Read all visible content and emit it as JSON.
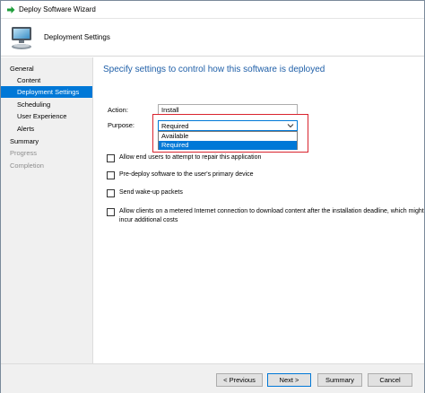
{
  "window": {
    "title": "Deploy Software Wizard",
    "accent_color": "#0078d7"
  },
  "header": {
    "page_name": "Deployment Settings"
  },
  "sidebar": {
    "items": [
      {
        "label": "General",
        "state": "normal"
      },
      {
        "label": "Content",
        "state": "normal"
      },
      {
        "label": "Deployment Settings",
        "state": "selected"
      },
      {
        "label": "Scheduling",
        "state": "normal"
      },
      {
        "label": "User Experience",
        "state": "normal"
      },
      {
        "label": "Alerts",
        "state": "normal"
      },
      {
        "label": "Summary",
        "state": "normal"
      },
      {
        "label": "Progress",
        "state": "disabled"
      },
      {
        "label": "Completion",
        "state": "disabled"
      }
    ]
  },
  "main": {
    "section_title": "Specify settings to control how this software is deployed",
    "action": {
      "label": "Action:",
      "value": "Install"
    },
    "purpose": {
      "label": "Purpose:",
      "value": "Required",
      "options": [
        "Available",
        "Required"
      ],
      "highlighted_option": "Required"
    },
    "checkboxes": [
      {
        "label": "Allow end users to attempt to repair this application",
        "checked": false
      },
      {
        "label": "Pre-deploy software to the user's primary device",
        "checked": false
      },
      {
        "label": "Send wake-up packets",
        "checked": false
      },
      {
        "label": "Allow clients on a metered Internet connection to download content after the installation deadline, which might incur additional costs",
        "checked": false
      }
    ],
    "highlight_color": "#d9232e"
  },
  "footer": {
    "previous": "< Previous",
    "next": "Next >",
    "summary": "Summary",
    "cancel": "Cancel"
  }
}
